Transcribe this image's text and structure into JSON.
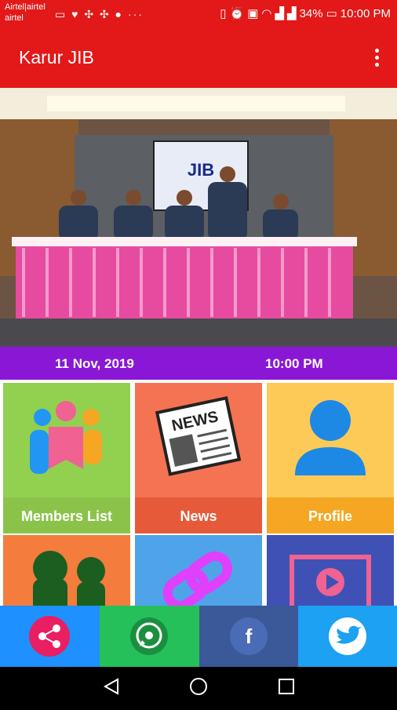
{
  "status_bar": {
    "carrier_line1": "Airtel|airtel",
    "carrier_line2": "airtel",
    "battery": "34%",
    "time": "10:00 PM"
  },
  "app_bar": {
    "title": "Karur JIB"
  },
  "banner": {
    "screen_text": "JIB"
  },
  "date_bar": {
    "date": "11 Nov, 2019",
    "time": "10:00 PM"
  },
  "tiles": [
    {
      "label": "Members List",
      "icon": "members-icon",
      "color": "#92d050",
      "label_color": "#8bc34a"
    },
    {
      "label": "News",
      "icon": "news-icon",
      "color": "#f47352",
      "label_color": "#e65a3a",
      "icon_text": "NEWS"
    },
    {
      "label": "Profile",
      "icon": "profile-icon",
      "color": "#fdca57",
      "label_color": "#f5a623"
    },
    {
      "label": "",
      "icon": "people-silhouette-icon",
      "color": "#f47c3c"
    },
    {
      "label": "",
      "icon": "link-icon",
      "color": "#4fa3e8"
    },
    {
      "label": "",
      "icon": "video-icon",
      "color": "#3f51b5"
    }
  ],
  "social": [
    {
      "name": "share",
      "icon": "share-icon",
      "color": "#1e90ff"
    },
    {
      "name": "whatsapp",
      "icon": "whatsapp-icon",
      "color": "#25c05a"
    },
    {
      "name": "facebook",
      "icon": "facebook-icon",
      "color": "#3b5998"
    },
    {
      "name": "twitter",
      "icon": "twitter-icon",
      "color": "#1da1f2"
    }
  ]
}
